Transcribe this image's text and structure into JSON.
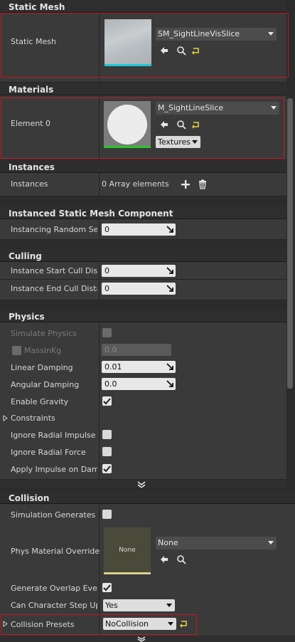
{
  "static_mesh_section": {
    "title": "Static Mesh",
    "row_label": "Static Mesh",
    "asset_name": "SM_SightLineVisSlice"
  },
  "materials_section": {
    "title": "Materials",
    "row_label": "Element 0",
    "asset_name": "M_SightLineSlice",
    "textures_label": "Textures"
  },
  "instances_section": {
    "title": "Instances",
    "row_label": "Instances",
    "value": "0 Array elements"
  },
  "ismc_section": {
    "title": "Instanced Static Mesh Component",
    "rows": [
      {
        "label": "Instancing Random Seed",
        "value": "0"
      }
    ]
  },
  "culling_section": {
    "title": "Culling",
    "rows": [
      {
        "label": "Instance Start Cull Distance",
        "value": "0"
      },
      {
        "label": "Instance End Cull Distance",
        "value": "0"
      }
    ]
  },
  "physics_section": {
    "title": "Physics",
    "simulate_physics": {
      "label": "Simulate Physics",
      "checked": false,
      "enabled": false
    },
    "mass_in_kg": {
      "label": "MassInKg",
      "value": "0.0",
      "enabled": false
    },
    "linear_damping": {
      "label": "Linear Damping",
      "value": "0.01"
    },
    "angular_damping": {
      "label": "Angular Damping",
      "value": "0.0"
    },
    "enable_gravity": {
      "label": "Enable Gravity",
      "checked": true
    },
    "constraints": {
      "label": "Constraints"
    },
    "ignore_radial_impulse": {
      "label": "Ignore Radial Impulse",
      "checked": false
    },
    "ignore_radial_force": {
      "label": "Ignore Radial Force",
      "checked": false
    },
    "apply_impulse": {
      "label": "Apply Impulse on Damage",
      "checked": true
    }
  },
  "collision_section": {
    "title": "Collision",
    "sim_generates_hit": {
      "label": "Simulation Generates Hit Events",
      "checked": false
    },
    "phys_material_override": {
      "label": "Phys Material Override",
      "thumbnail_text": "None",
      "value": "None"
    },
    "generate_overlap": {
      "label": "Generate Overlap Events",
      "checked": true
    },
    "can_step_up": {
      "label": "Can Character Step Up On",
      "value": "Yes"
    },
    "collision_presets": {
      "label": "Collision Presets",
      "value": "NoCollision"
    }
  },
  "colors": {
    "panel_bg": "#3a3a3a",
    "header_bg": "#2e2e2e",
    "highlight_red": "#c4181e",
    "mesh_bar": "#1fc8d8",
    "material_bar": "#27c52e",
    "physmat_bar": "#d8cf8e"
  },
  "icons": [
    "arrow-left-icon",
    "search-icon",
    "reset-arrow-icon",
    "add-icon",
    "trash-icon",
    "dropdown-arrow-icon",
    "checkmark-icon",
    "expand-arrow-icon",
    "chevron-down-icon"
  ]
}
